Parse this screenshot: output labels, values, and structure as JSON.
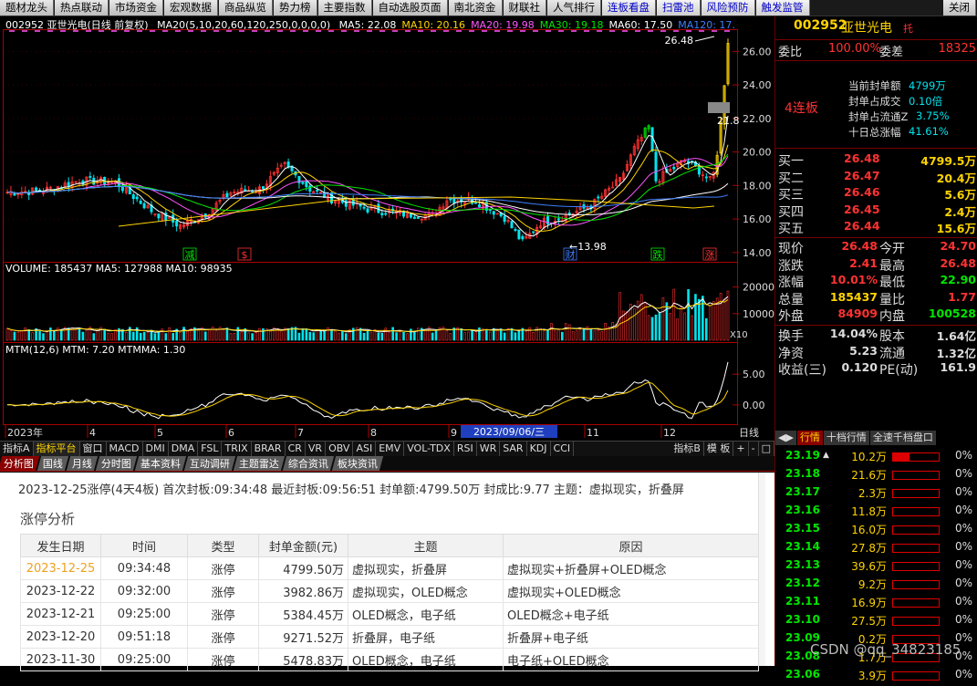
{
  "topbar": {
    "tabs": [
      "题材龙头",
      "热点联动",
      "市场资金",
      "宏观数据",
      "商品纵览",
      "势力榜",
      "主要指数",
      "自动选股页面",
      "南北资金",
      "财联社",
      "人气排行",
      "连板看盘",
      "扫雷池",
      "风险预防",
      "触发监管"
    ],
    "close": "关闭"
  },
  "chart": {
    "header": "002952 亚世光电(日线 前复权)",
    "ma_param": "MA20(5,10,20,60,120,250,0,0,0,0)",
    "ma_values": [
      {
        "label": "MA5: 22.08",
        "color": "#ffffff"
      },
      {
        "label": "MA10: 20.16",
        "color": "#ffd400"
      },
      {
        "label": "MA20: 19.98",
        "color": "#ff55ff"
      },
      {
        "label": "MA30: 19.18",
        "color": "#00e600"
      },
      {
        "label": "MA60: 17.50",
        "color": "#ffffff"
      },
      {
        "label": "MA120: 17.",
        "color": "#3f7fff"
      }
    ],
    "price_ticks": [
      "26.00",
      "24.00",
      "22.00",
      "20.00",
      "18.00",
      "16.00",
      "14.00"
    ],
    "high_label": "26.48",
    "low_label": "13.98",
    "mark_label": "21.8",
    "markers": [
      {
        "text": "减",
        "color": "#00e600"
      },
      {
        "text": "$",
        "color": "#ff3232"
      },
      {
        "text": "财",
        "color": "#3f7fff"
      },
      {
        "text": "跌",
        "color": "#00e600"
      },
      {
        "text": "涨",
        "color": "#ff3232"
      }
    ],
    "volume_header": "VOLUME: 185437 MA5: 127988 MA10: 98935",
    "volume_ticks": [
      "20000",
      "10000"
    ],
    "volume_unit": "X10",
    "mtm_header": "MTM(12,6) MTM: 7.20 MTMMA: 1.30",
    "mtm_ticks": [
      "5.00",
      "0.00"
    ],
    "x_labels": [
      "2023年",
      "4",
      "5",
      "6",
      "7",
      "8",
      "9",
      "11",
      "12"
    ],
    "x_highlight": "2023/09/06/三",
    "x_period": "日线"
  },
  "chart_data": {
    "type": "candlestick",
    "title": "002952 亚世光电(日线 前复权)",
    "ylim": [
      13.5,
      27
    ],
    "high": 26.48,
    "low": 13.98,
    "last_days": [
      {
        "date": "2023-12-20",
        "close": 19.8
      },
      {
        "date": "2023-12-21",
        "close": 21.78
      },
      {
        "date": "2023-12-22",
        "close": 23.96
      },
      {
        "date": "2023-12-25",
        "close": 26.48
      }
    ],
    "volume": 185437,
    "mtm": 7.2,
    "mtmma": 1.3
  },
  "indicator_tabs": [
    "指标A",
    "指标平台",
    "窗口",
    "MACD",
    "DMI",
    "DMA",
    "FSL",
    "TRIX",
    "BRAR",
    "CR",
    "VR",
    "OBV",
    "ASI",
    "EMV",
    "VOL-TDX",
    "RSI",
    "WR",
    "SAR",
    "KDJ",
    "CCI"
  ],
  "indicator_right": [
    "指标B",
    "模 板",
    "+",
    "-",
    "□"
  ],
  "bottom_tabs": [
    "分析图",
    "国线",
    "月线",
    "分时图",
    "基本资料",
    "互动调研",
    "主题雷达",
    "综合资讯",
    "板块资讯"
  ],
  "panel": {
    "summary": "2023-12-25涨停(4天4板) 首次封板:09:34:48 最近封板:09:56:51 封单额:4799.50万 封成比:9.77 主题：虚拟现实，折叠屏",
    "section_title": "涨停分析",
    "columns": [
      "发生日期",
      "时间",
      "类型",
      "封单金额(元)",
      "主题",
      "原因"
    ],
    "rows": [
      [
        "2023-12-25",
        "09:34:48",
        "涨停",
        "4799.50万",
        "虚拟现实，折叠屏",
        "虚拟现实+折叠屏+OLED概念"
      ],
      [
        "2023-12-22",
        "09:32:00",
        "涨停",
        "3982.86万",
        "虚拟现实，OLED概念",
        "虚拟现实+OLED概念"
      ],
      [
        "2023-12-21",
        "09:25:00",
        "涨停",
        "5384.45万",
        "OLED概念，电子纸",
        "OLED概念+电子纸"
      ],
      [
        "2023-12-20",
        "09:51:18",
        "涨停",
        "9271.52万",
        "折叠屏，电子纸",
        "折叠屏+电子纸"
      ],
      [
        "2023-11-30",
        "09:25:00",
        "涨停",
        "5478.83万",
        "OLED概念，电子纸",
        "电子纸+OLED概念"
      ]
    ]
  },
  "right": {
    "code": "002952",
    "name": "亚世光电",
    "tag": "托",
    "weibi_label": "委比",
    "weibi": "100.00%",
    "weicha_label": "委差",
    "weicha": "18325",
    "lianban": "4连板",
    "seal": [
      {
        "k": "当前封单额",
        "v": "4799万"
      },
      {
        "k": "封单占成交",
        "v": "0.10倍"
      },
      {
        "k": "封单占流通Z",
        "v": "3.75%"
      },
      {
        "k": "十日总涨幅",
        "v": "41.61%"
      }
    ],
    "buys": [
      {
        "k": "买一",
        "p": "26.48",
        "q": "4799.5万"
      },
      {
        "k": "买二",
        "p": "26.47",
        "q": "20.4万"
      },
      {
        "k": "买三",
        "p": "26.46",
        "q": "5.6万"
      },
      {
        "k": "买四",
        "p": "26.45",
        "q": "2.4万"
      },
      {
        "k": "买五",
        "p": "26.44",
        "q": "15.6万"
      }
    ],
    "stats": [
      {
        "k1": "现价",
        "v1": "26.48",
        "c1": "red",
        "k2": "今开",
        "v2": "24.70",
        "c2": "red"
      },
      {
        "k1": "涨跌",
        "v1": "2.41",
        "c1": "red",
        "k2": "最高",
        "v2": "26.48",
        "c2": "red"
      },
      {
        "k1": "涨幅",
        "v1": "10.01%",
        "c1": "red",
        "k2": "最低",
        "v2": "22.90",
        "c2": "green"
      },
      {
        "k1": "总量",
        "v1": "185437",
        "c1": "yel",
        "k2": "量比",
        "v2": "1.77",
        "c2": "red"
      },
      {
        "k1": "外盘",
        "v1": "84909",
        "c1": "red",
        "k2": "内盘",
        "v2": "100528",
        "c2": "green"
      }
    ],
    "stats2": [
      {
        "k1": "换手",
        "v1": "14.04%",
        "k2": "股本",
        "v2": "1.64亿"
      },
      {
        "k1": "净资",
        "v1": "5.23",
        "k2": "流通",
        "v2": "1.32亿"
      },
      {
        "k1": "收益(三)",
        "v1": "0.120",
        "k2": "PE(动)",
        "v2": "161.9"
      }
    ],
    "tabs": [
      "行情",
      "十档行情",
      "全速千档盘口"
    ],
    "ticks": [
      {
        "p": "23.19",
        "q": "10.2万",
        "pct": "0%",
        "fill": 0.35,
        "arrow": "▲"
      },
      {
        "p": "23.18",
        "q": "21.6万",
        "pct": "0%",
        "fill": 0.0,
        "arrow": ""
      },
      {
        "p": "23.17",
        "q": "2.3万",
        "pct": "0%",
        "fill": 0.0,
        "arrow": ""
      },
      {
        "p": "23.16",
        "q": "11.8万",
        "pct": "0%",
        "fill": 0.0,
        "arrow": ""
      },
      {
        "p": "23.15",
        "q": "16.0万",
        "pct": "0%",
        "fill": 0.0,
        "arrow": ""
      },
      {
        "p": "23.14",
        "q": "27.8万",
        "pct": "0%",
        "fill": 0.0,
        "arrow": ""
      },
      {
        "p": "23.13",
        "q": "39.6万",
        "pct": "0%",
        "fill": 0.0,
        "arrow": ""
      },
      {
        "p": "23.12",
        "q": "9.2万",
        "pct": "0%",
        "fill": 0.0,
        "arrow": ""
      },
      {
        "p": "23.11",
        "q": "16.9万",
        "pct": "0%",
        "fill": 0.0,
        "arrow": ""
      },
      {
        "p": "23.10",
        "q": "27.5万",
        "pct": "0%",
        "fill": 0.0,
        "arrow": ""
      },
      {
        "p": "23.09",
        "q": "0.2万",
        "pct": "0%",
        "fill": 0.0,
        "arrow": ""
      },
      {
        "p": "23.08",
        "q": "1.7万",
        "pct": "0%",
        "fill": 0.0,
        "arrow": ""
      },
      {
        "p": "23.06",
        "q": "3.9万",
        "pct": "0%",
        "fill": 0.0,
        "arrow": ""
      }
    ]
  },
  "watermark": "CSDN @qq_34823185"
}
